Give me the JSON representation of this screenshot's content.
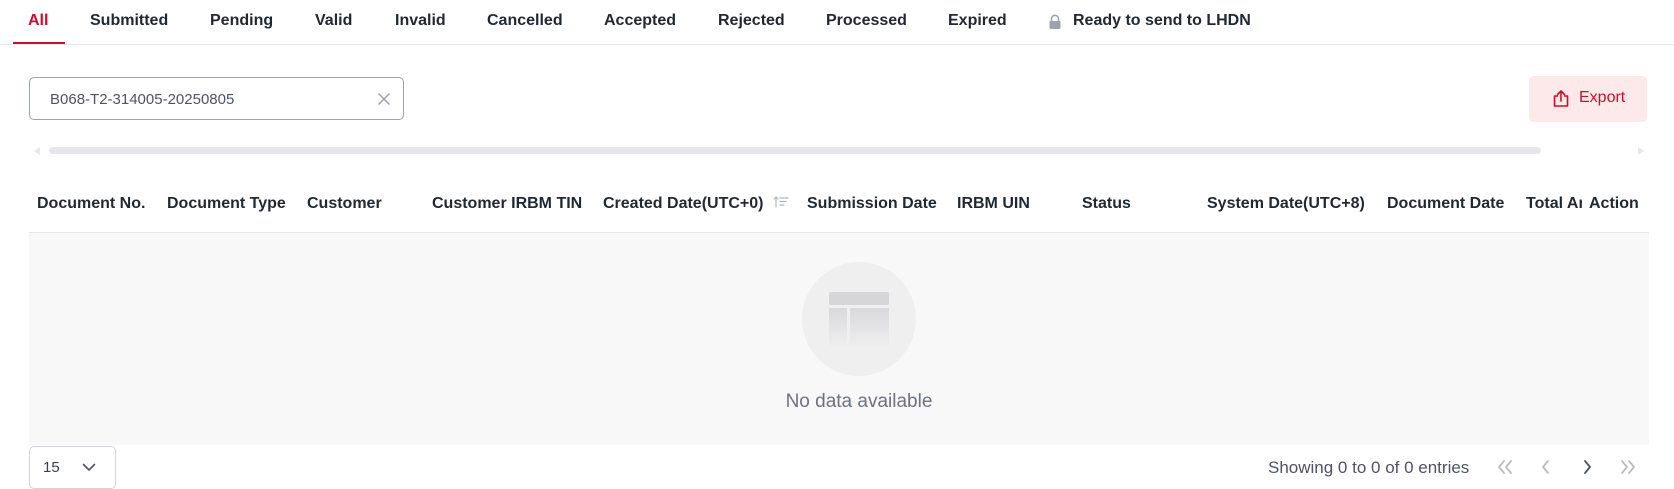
{
  "tabs": [
    {
      "label": "All",
      "active": true
    },
    {
      "label": "Submitted"
    },
    {
      "label": "Pending"
    },
    {
      "label": "Valid"
    },
    {
      "label": "Invalid"
    },
    {
      "label": "Cancelled"
    },
    {
      "label": "Accepted"
    },
    {
      "label": "Rejected"
    },
    {
      "label": "Processed"
    },
    {
      "label": "Expired"
    },
    {
      "label": "Ready to send to LHDN",
      "icon": "lock-icon"
    }
  ],
  "search": {
    "value": "B068-T2-314005-20250805"
  },
  "export": {
    "label": "Export",
    "icon": "export-upload-icon"
  },
  "table": {
    "columns": [
      "Document No.",
      "Document Type",
      "Customer",
      "Customer IRBM TIN",
      "Created Date(UTC+0)",
      "Submission Date",
      "IRBM UIN",
      "Status",
      "System Date(UTC+8)",
      "Document Date",
      "Total Amount",
      "Action"
    ],
    "sorted_column": "Created Date(UTC+0)",
    "rows": [],
    "empty_text": "No data available"
  },
  "pagination": {
    "page_size": "15",
    "entries_text": "Showing 0 to 0 of 0 entries"
  },
  "colors": {
    "accent": "#c8102e",
    "export_bg": "#fde8ea",
    "empty_bg": "#f8f8f9"
  }
}
